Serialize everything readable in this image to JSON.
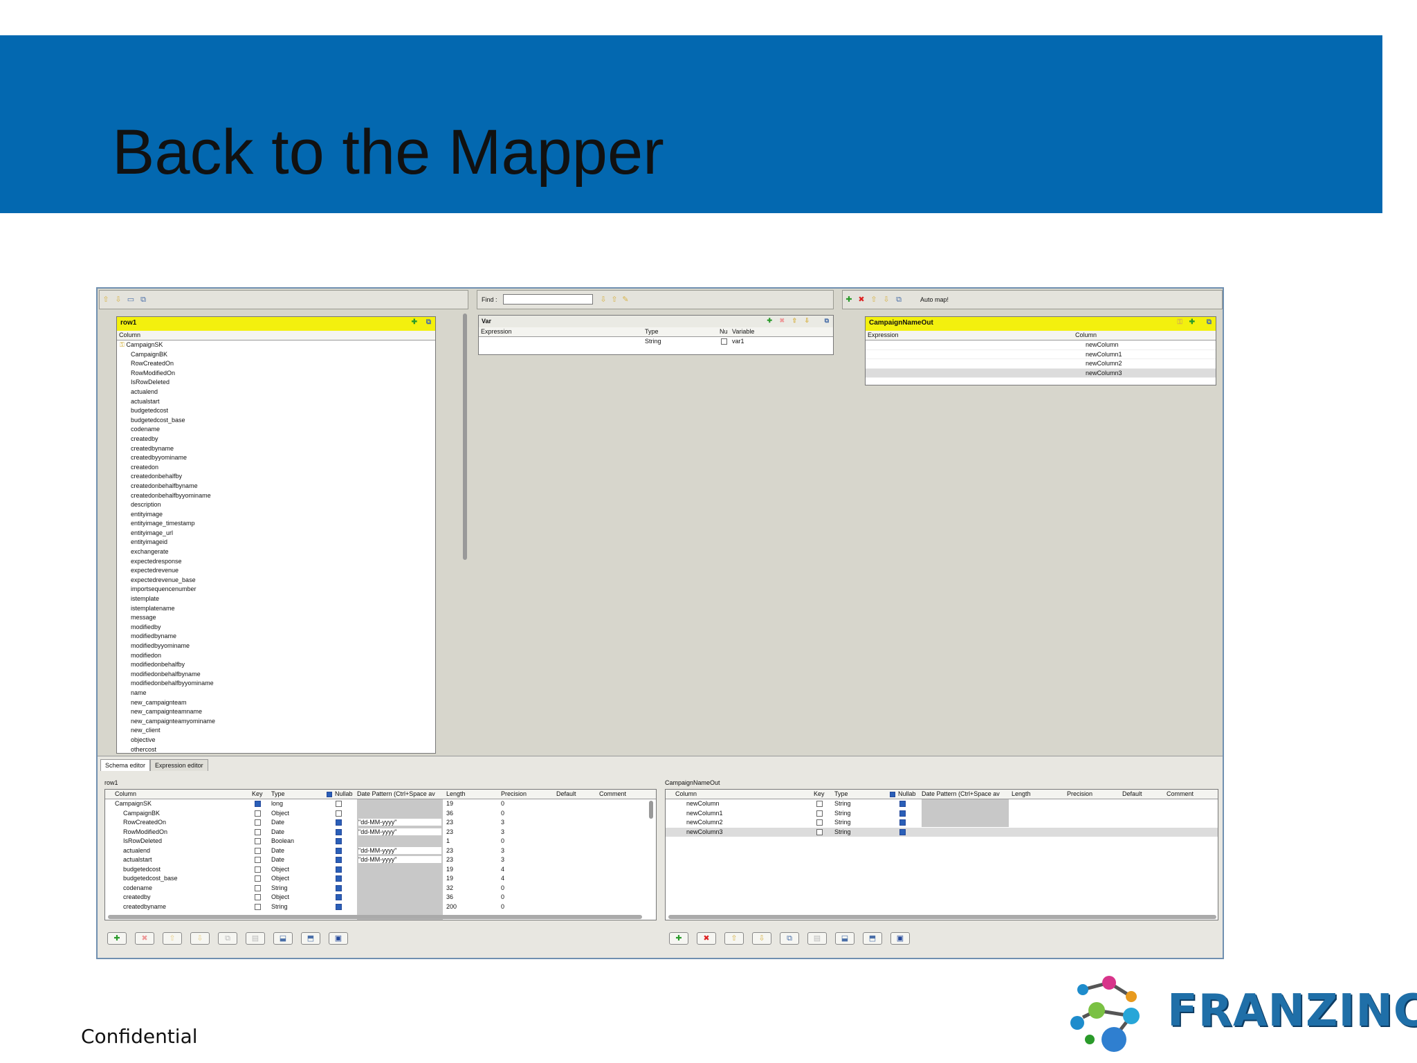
{
  "slide": {
    "title": "Back to the Mapper",
    "footer": "Confidential",
    "logo_text": "FRANZINC.",
    "accent": "#0368b0"
  },
  "input_panel": {
    "table_name": "row1",
    "column_header": "Column",
    "columns": [
      "CampaignSK",
      "CampaignBK",
      "RowCreatedOn",
      "RowModifiedOn",
      "IsRowDeleted",
      "actualend",
      "actualstart",
      "budgetedcost",
      "budgetedcost_base",
      "codename",
      "createdby",
      "createdbyname",
      "createdbyyominame",
      "createdon",
      "createdonbehalfby",
      "createdonbehalfbyname",
      "createdonbehalfbyyominame",
      "description",
      "entityimage",
      "entityimage_timestamp",
      "entityimage_url",
      "entityimageid",
      "exchangerate",
      "expectedresponse",
      "expectedrevenue",
      "expectedrevenue_base",
      "importsequencenumber",
      "istemplate",
      "istemplatename",
      "message",
      "modifiedby",
      "modifiedbyname",
      "modifiedbyyominame",
      "modifiedon",
      "modifiedonbehalfby",
      "modifiedonbehalfbyname",
      "modifiedonbehalfbyyominame",
      "name",
      "new_campaignteam",
      "new_campaignteamname",
      "new_campaignteamyominame",
      "new_client",
      "objective",
      "othercost"
    ]
  },
  "var_panel": {
    "find_label": "Find :",
    "find_value": "",
    "title": "Var",
    "headers": {
      "expression": "Expression",
      "type": "Type",
      "nullable": "Nu",
      "variable": "Variable"
    },
    "rows": [
      {
        "expression": "",
        "type": "String",
        "variable": "var1"
      }
    ]
  },
  "output_panel": {
    "auto_map_label": "Auto map!",
    "table_name": "CampaignNameOut",
    "headers": {
      "expression": "Expression",
      "column": "Column"
    },
    "columns": [
      "newColumn",
      "newColumn1",
      "newColumn2",
      "newColumn3"
    ]
  },
  "schema_editor": {
    "tabs": [
      "Schema editor",
      "Expression editor"
    ],
    "left_title": "row1",
    "right_title": "CampaignNameOut",
    "headers": {
      "column": "Column",
      "key": "Key",
      "type": "Type",
      "nullable": "Nullab",
      "date_pattern": "Date Pattern (Ctrl+Space av",
      "length": "Length",
      "precision": "Precision",
      "default": "Default",
      "comment": "Comment"
    },
    "left_rows": [
      {
        "column": "CampaignSK",
        "key": true,
        "type": "long",
        "nullable": false,
        "pattern": "",
        "length": "19",
        "precision": "0"
      },
      {
        "column": "CampaignBK",
        "key": false,
        "type": "Object",
        "nullable": false,
        "pattern": "",
        "length": "36",
        "precision": "0"
      },
      {
        "column": "RowCreatedOn",
        "key": false,
        "type": "Date",
        "nullable": true,
        "pattern": "\"dd-MM-yyyy\"",
        "length": "23",
        "precision": "3"
      },
      {
        "column": "RowModifiedOn",
        "key": false,
        "type": "Date",
        "nullable": true,
        "pattern": "\"dd-MM-yyyy\"",
        "length": "23",
        "precision": "3"
      },
      {
        "column": "IsRowDeleted",
        "key": false,
        "type": "Boolean",
        "nullable": true,
        "pattern": "",
        "length": "1",
        "precision": "0"
      },
      {
        "column": "actualend",
        "key": false,
        "type": "Date",
        "nullable": true,
        "pattern": "\"dd-MM-yyyy\"",
        "length": "23",
        "precision": "3"
      },
      {
        "column": "actualstart",
        "key": false,
        "type": "Date",
        "nullable": true,
        "pattern": "\"dd-MM-yyyy\"",
        "length": "23",
        "precision": "3"
      },
      {
        "column": "budgetedcost",
        "key": false,
        "type": "Object",
        "nullable": true,
        "pattern": "",
        "length": "19",
        "precision": "4"
      },
      {
        "column": "budgetedcost_base",
        "key": false,
        "type": "Object",
        "nullable": true,
        "pattern": "",
        "length": "19",
        "precision": "4"
      },
      {
        "column": "codename",
        "key": false,
        "type": "String",
        "nullable": true,
        "pattern": "",
        "length": "32",
        "precision": "0"
      },
      {
        "column": "createdby",
        "key": false,
        "type": "Object",
        "nullable": true,
        "pattern": "",
        "length": "36",
        "precision": "0"
      },
      {
        "column": "createdbyname",
        "key": false,
        "type": "String",
        "nullable": true,
        "pattern": "",
        "length": "200",
        "precision": "0"
      }
    ],
    "right_rows": [
      {
        "column": "newColumn",
        "key": false,
        "type": "String",
        "nullable": true
      },
      {
        "column": "newColumn1",
        "key": false,
        "type": "String",
        "nullable": true
      },
      {
        "column": "newColumn2",
        "key": false,
        "type": "String",
        "nullable": true
      },
      {
        "column": "newColumn3",
        "key": false,
        "type": "String",
        "nullable": true
      }
    ]
  }
}
